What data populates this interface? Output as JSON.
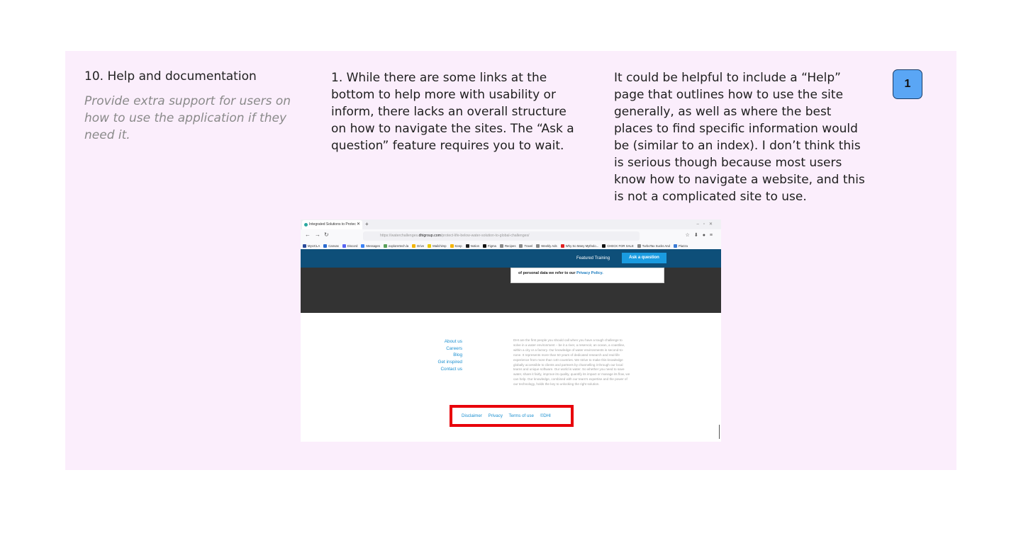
{
  "heuristic": {
    "title": "10. Help and documentation",
    "description": "Provide extra support for users on how to use the application if they need it."
  },
  "issue_text": "1. While there are some links at the bottom to help more with usability or inform, there lacks an overall structure on how to navigate the sites. The “Ask a question” feature requires you to wait.",
  "recommendation_text": "It could be helpful to include a “Help” page that outlines how to use the site generally, as well as where the best places to find specific information would be (similar to an index). I don’t think this is serious though because most users know how to navigate a website, and this is not a complicated site to use.",
  "severity": "1",
  "screenshot": {
    "tab_title": "Integrated Solutions to Protec",
    "url_pre": "https://waterchallenges.",
    "url_domain": "dhigroup.com",
    "url_post": "/protect-life-below-water-solution-to-global-challenges/",
    "bookmarks": [
      {
        "label": "MyUCLA",
        "color": "#2a4a9a"
      },
      {
        "label": "Canvas",
        "color": "#2a6ad0"
      },
      {
        "label": "Discord",
        "color": "#5865f2"
      },
      {
        "label": "Messages",
        "color": "#3b82f6"
      },
      {
        "label": "explorertech.la",
        "color": "#5aa05a"
      },
      {
        "label": "Drive",
        "color": "#f2b400"
      },
      {
        "label": "Mailchimp",
        "color": "#e8c800"
      },
      {
        "label": "Keep",
        "color": "#f4b400"
      },
      {
        "label": "Notion",
        "color": "#222222"
      },
      {
        "label": "Figma",
        "color": "#111111"
      },
      {
        "label": "Recipes",
        "color": "#888888"
      },
      {
        "label": "Travel",
        "color": "#888888"
      },
      {
        "label": "Weekly Ads",
        "color": "#888888"
      },
      {
        "label": "Why So Many Mytholo...",
        "color": "#e02020"
      },
      {
        "label": "CHECK FOR SALE",
        "color": "#111111"
      },
      {
        "label": "TurboTax Sucks And",
        "color": "#888888"
      },
      {
        "label": "Piazza",
        "color": "#3a7bd5"
      }
    ],
    "featured_label": "Featured Training",
    "ask_label": "Ask a question",
    "popup_text": "of personal data we refer to our ",
    "popup_link": "Privacy Policy.",
    "footer_links": [
      "About us",
      "Careers",
      "Blog",
      "Get inspired",
      "Contact us"
    ],
    "about_text": "DHI are the first people you should call when you have a tough challenge to solve in a water environment – be it a river, a reservoir, an ocean, a coastline, within a city or a factory. Our knowledge of water environments is second-to-none. It represents more than 50 years of dedicated research and real-life experience from more than 140 countries. We strive to make this knowledge globally accessible to clients and partners by channelling it through our local teams and unique software. Our world is water. So whether you need to save water, share it fairly, improve its quality, quantify its impact or manage its flow, we can help. Our knowledge, combined with our team's expertise and the power of our technology, holds the key to unlocking the right solution.",
    "legal_links": [
      "Disclaimer",
      "Privacy",
      "Terms of use",
      "©DHI"
    ]
  }
}
